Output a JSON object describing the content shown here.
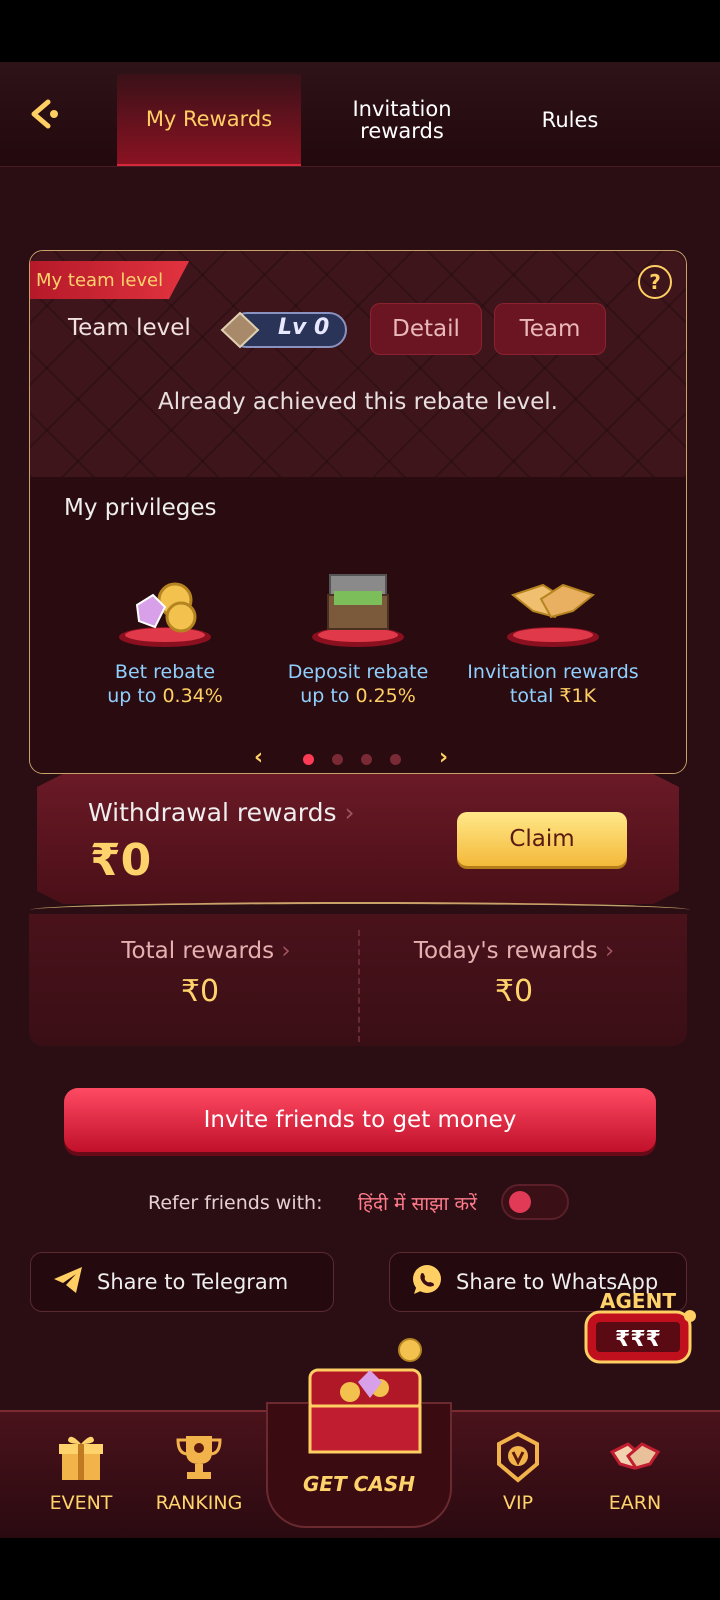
{
  "header": {
    "tabs": [
      {
        "label": "My Rewards",
        "active": true
      },
      {
        "label": "Invitation rewards",
        "active": false
      },
      {
        "label": "Rules",
        "active": false
      }
    ]
  },
  "team": {
    "ribbon": "My team level",
    "level_label": "Team level",
    "level_badge": "Lv 0",
    "detail_btn": "Detail",
    "team_btn": "Team",
    "status": "Already achieved this rebate level."
  },
  "privileges": {
    "title": "My privileges",
    "items": [
      {
        "name": "Bet rebate",
        "prefix": "up to ",
        "value": "0.34%",
        "icon": "coins-gems-icon"
      },
      {
        "name": "Deposit rebate",
        "prefix": "up to ",
        "value": "0.25%",
        "icon": "cash-chest-icon"
      },
      {
        "name": "Invitation rewards",
        "prefix": "total ",
        "value": "₹1K",
        "icon": "handshake-icon"
      }
    ],
    "page_index": 1,
    "page_count": 4
  },
  "withdrawal": {
    "label": "Withdrawal rewards",
    "value": "₹0",
    "claim": "Claim"
  },
  "totals": {
    "total_label": "Total rewards",
    "total_value": "₹0",
    "today_label": "Today's rewards",
    "today_value": "₹0"
  },
  "invite_button": "Invite friends to get money",
  "refer": {
    "label": "Refer friends with:",
    "hindi": "हिंदी में साझा करें",
    "enabled": false
  },
  "share": {
    "telegram": "Share to Telegram",
    "whatsapp": "Share to WhatsApp"
  },
  "agent": {
    "label": "AGENT",
    "symbols": "₹₹₹"
  },
  "nav": {
    "event": "EVENT",
    "ranking": "RANKING",
    "getcash": "GET CASH",
    "vip": "VIP",
    "earn": "EARN"
  },
  "colors": {
    "accent_gold": "#ffcf63",
    "accent_red": "#e2333f",
    "background": "#2a0e13"
  }
}
